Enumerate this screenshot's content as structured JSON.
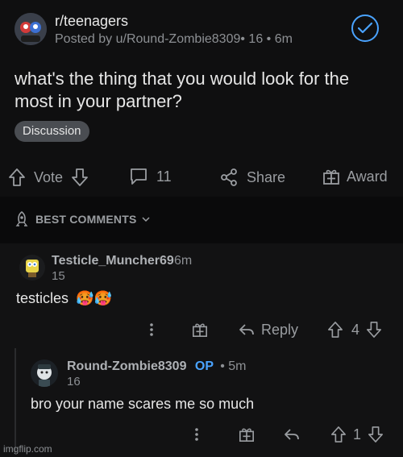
{
  "post": {
    "subreddit": "r/teenagers",
    "posted_by_prefix": "Posted by u/Round-Zombie8309",
    "meta": "• 16 • 6m",
    "title": "what's the thing that you would look for the most in your partner?",
    "flair": "Discussion",
    "vote_label": "Vote",
    "comment_count": "11",
    "share_label": "Share",
    "award_label": "Award"
  },
  "sort": {
    "label": "BEST COMMENTS"
  },
  "comments": [
    {
      "user": "Testicle_Muncher69",
      "time": "6m",
      "score": "15",
      "body": "testicles",
      "emoji": "🥵🥵",
      "reply_label": "Reply",
      "votes": "4"
    },
    {
      "user": "Round-Zombie8309",
      "op": "OP",
      "time": "• 5m",
      "score": "16",
      "body": "bro your name scares me so much",
      "votes": "1"
    }
  ],
  "watermark": "imgflip.com",
  "colors": {
    "accent": "#4aa3ff",
    "background": "#0b0b0c",
    "muted": "#9a9da1"
  }
}
